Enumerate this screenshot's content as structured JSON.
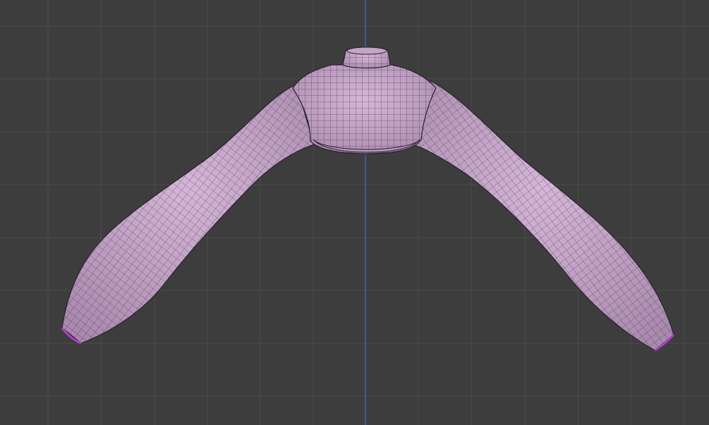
{
  "viewport": {
    "background_color": "#3d3d3d",
    "grid_color": "#4b4b4b",
    "axis_color": "#2f78c4",
    "mode": "wireframe-overlay"
  },
  "mesh": {
    "object": "turtleneck-crop-sweater",
    "fill_color": "#c9a7cc",
    "wire_color": "#1d1620",
    "selected_edge_color": "#b13fd0"
  }
}
